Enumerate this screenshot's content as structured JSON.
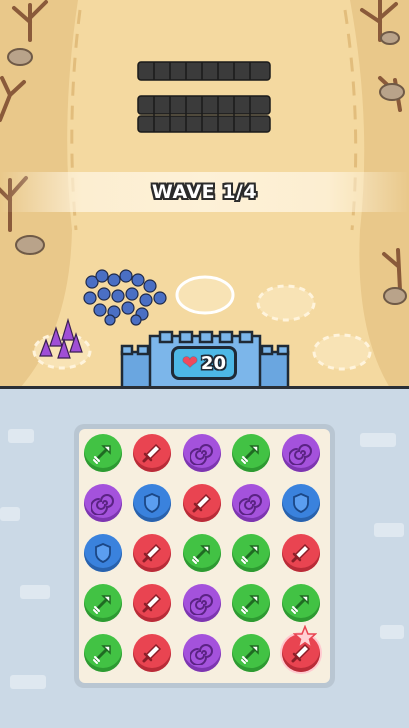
{
  "wave": {
    "label": "WAVE 1/4"
  },
  "castle": {
    "hp": "20",
    "heart_icon": "heart-icon"
  },
  "gem_types": {
    "arrow": {
      "icon": "arrow-icon",
      "color": "#42c244"
    },
    "sword": {
      "icon": "sword-icon",
      "color": "#e94451"
    },
    "magic": {
      "icon": "magic-swirl-icon",
      "color": "#a452dc"
    },
    "shield": {
      "icon": "shield-icon",
      "color": "#3a82dd"
    }
  },
  "board": {
    "rows": 5,
    "cols": 5,
    "grid": [
      [
        "arrow",
        "sword",
        "magic",
        "arrow",
        "magic"
      ],
      [
        "magic",
        "shield",
        "sword",
        "magic",
        "shield"
      ],
      [
        "shield",
        "sword",
        "arrow",
        "arrow",
        "sword"
      ],
      [
        "arrow",
        "sword",
        "magic",
        "arrow",
        "arrow"
      ],
      [
        "arrow",
        "sword",
        "magic",
        "arrow",
        "sword"
      ]
    ],
    "highlighted": {
      "row": 4,
      "col": 4,
      "badge": "star-icon"
    }
  },
  "army": {
    "enemy_count": 16,
    "ally_knight_count": 18,
    "ally_mage_count": 5,
    "empty_slots": 4
  }
}
